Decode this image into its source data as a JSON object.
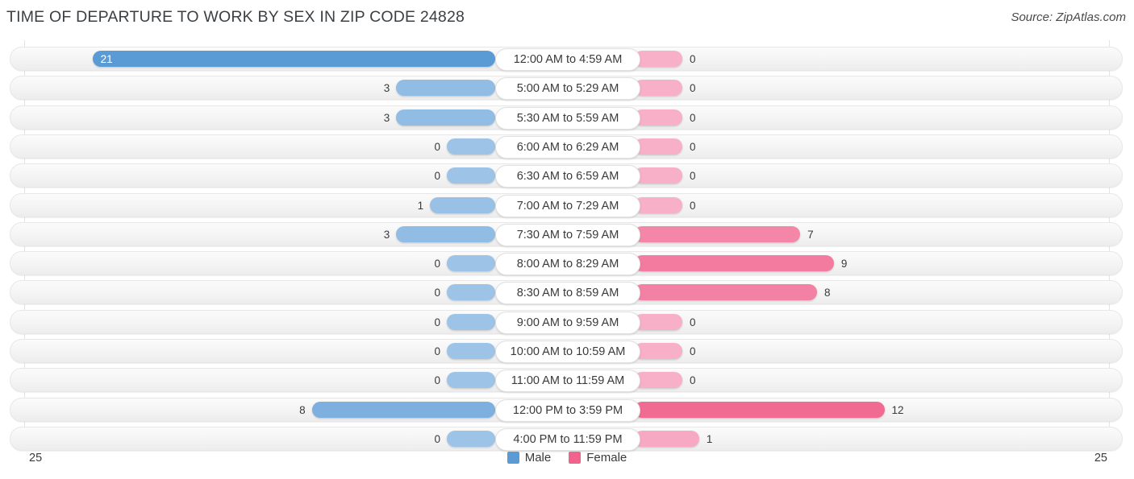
{
  "header": {
    "title": "TIME OF DEPARTURE TO WORK BY SEX IN ZIP CODE 24828",
    "source": "Source: ZipAtlas.com"
  },
  "legend": {
    "male_label": "Male",
    "female_label": "Female",
    "male_color": "#5B9BD5",
    "female_color": "#F0638C"
  },
  "axis": {
    "left_tick": "25",
    "right_tick": "25",
    "max": 25
  },
  "chart_data": {
    "type": "bar",
    "title": "TIME OF DEPARTURE TO WORK BY SEX IN ZIP CODE 24828",
    "subtitle": "Source: ZipAtlas.com",
    "orientation": "horizontal-diverging",
    "xlabel": "",
    "ylabel": "",
    "xlim": [
      25,
      25
    ],
    "grid": false,
    "legend_position": "bottom-center",
    "categories": [
      "12:00 AM to 4:59 AM",
      "5:00 AM to 5:29 AM",
      "5:30 AM to 5:59 AM",
      "6:00 AM to 6:29 AM",
      "6:30 AM to 6:59 AM",
      "7:00 AM to 7:29 AM",
      "7:30 AM to 7:59 AM",
      "8:00 AM to 8:29 AM",
      "8:30 AM to 8:59 AM",
      "9:00 AM to 9:59 AM",
      "10:00 AM to 10:59 AM",
      "11:00 AM to 11:59 AM",
      "12:00 PM to 3:59 PM",
      "4:00 PM to 11:59 PM"
    ],
    "series": [
      {
        "name": "Male",
        "color": "#5B9BD5",
        "values": [
          21,
          3,
          3,
          0,
          0,
          1,
          3,
          0,
          0,
          0,
          0,
          0,
          8,
          0
        ]
      },
      {
        "name": "Female",
        "color": "#F0638C",
        "values": [
          0,
          0,
          0,
          0,
          0,
          0,
          7,
          9,
          8,
          0,
          0,
          0,
          12,
          1
        ]
      }
    ]
  },
  "rows": [
    {
      "label": "12:00 AM to 4:59 AM",
      "male": "21",
      "female": "0"
    },
    {
      "label": "5:00 AM to 5:29 AM",
      "male": "3",
      "female": "0"
    },
    {
      "label": "5:30 AM to 5:59 AM",
      "male": "3",
      "female": "0"
    },
    {
      "label": "6:00 AM to 6:29 AM",
      "male": "0",
      "female": "0"
    },
    {
      "label": "6:30 AM to 6:59 AM",
      "male": "0",
      "female": "0"
    },
    {
      "label": "7:00 AM to 7:29 AM",
      "male": "1",
      "female": "0"
    },
    {
      "label": "7:30 AM to 7:59 AM",
      "male": "3",
      "female": "7"
    },
    {
      "label": "8:00 AM to 8:29 AM",
      "male": "0",
      "female": "9"
    },
    {
      "label": "8:30 AM to 8:59 AM",
      "male": "0",
      "female": "8"
    },
    {
      "label": "9:00 AM to 9:59 AM",
      "male": "0",
      "female": "0"
    },
    {
      "label": "10:00 AM to 10:59 AM",
      "male": "0",
      "female": "0"
    },
    {
      "label": "11:00 AM to 11:59 AM",
      "male": "0",
      "female": "0"
    },
    {
      "label": "12:00 PM to 3:59 PM",
      "male": "8",
      "female": "12"
    },
    {
      "label": "4:00 PM to 11:59 PM",
      "male": "0",
      "female": "1"
    }
  ]
}
